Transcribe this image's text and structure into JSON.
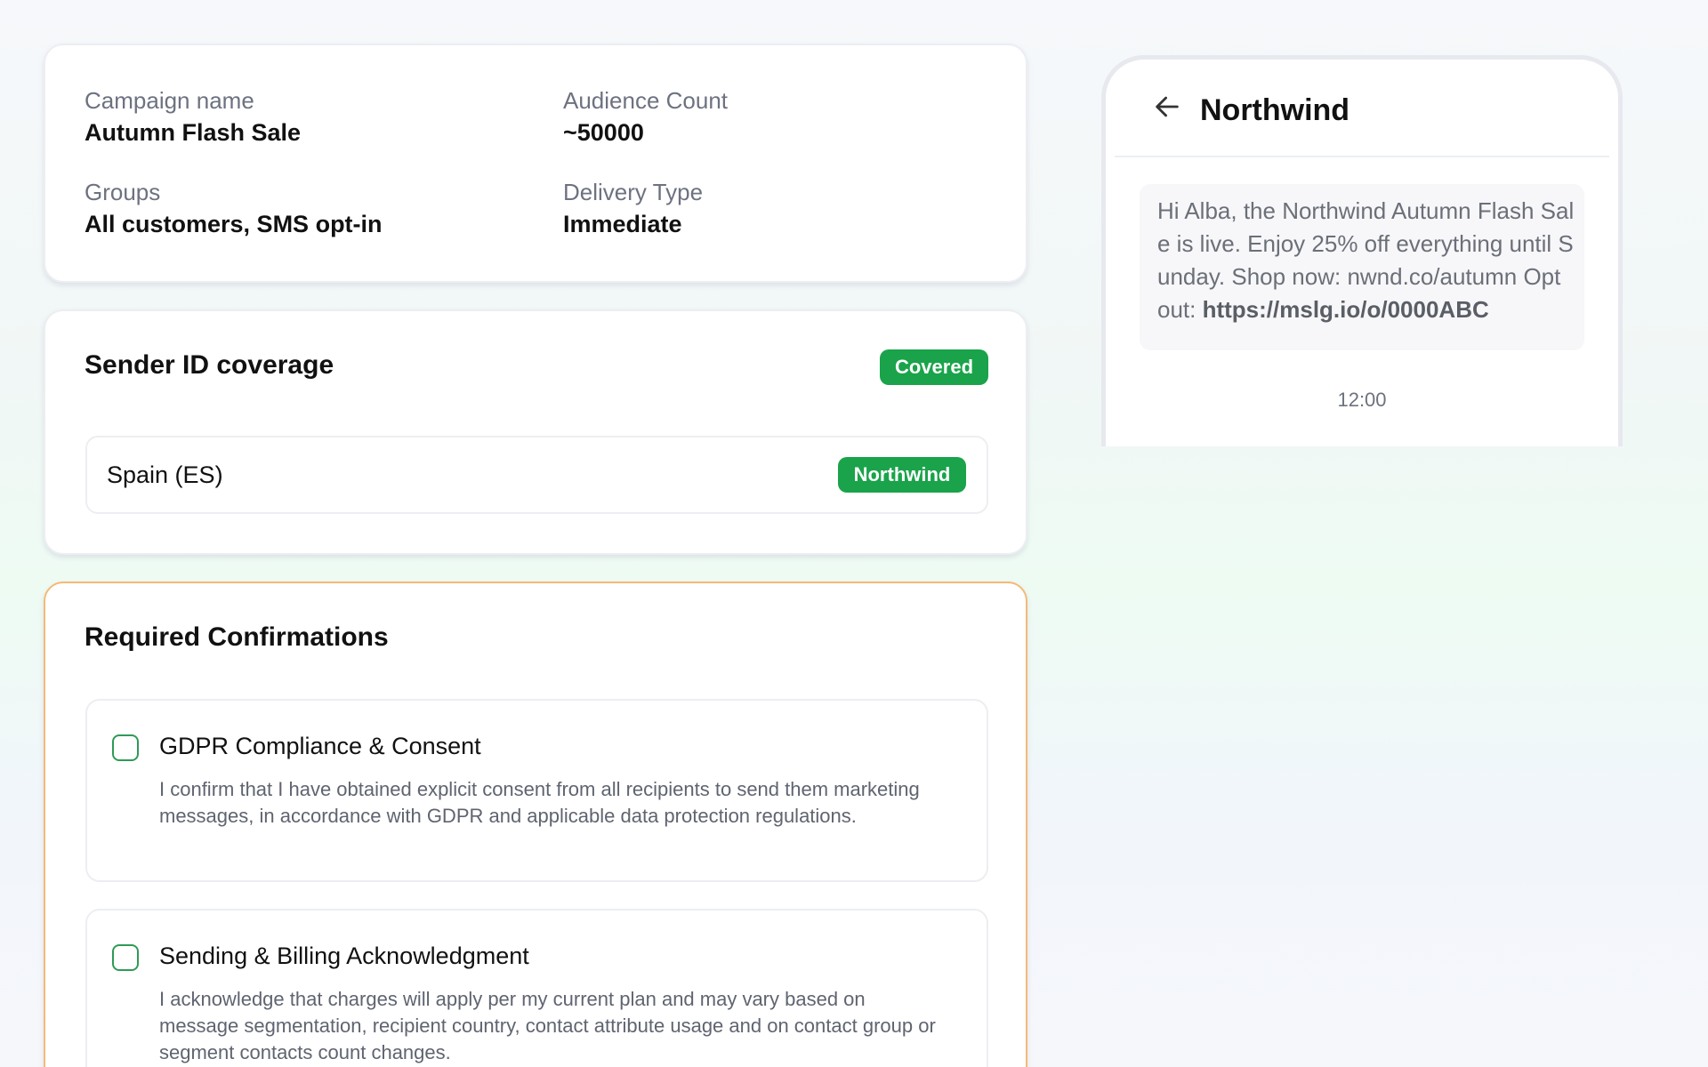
{
  "summary": {
    "campaign_name_label": "Campaign name",
    "campaign_name_value": "Autumn Flash Sale",
    "audience_label": "Audience Count",
    "audience_value": "~50000",
    "groups_label": "Groups",
    "groups_value": "All customers, SMS opt-in",
    "delivery_label": "Delivery Type",
    "delivery_value": "Immediate"
  },
  "sender": {
    "title": "Sender ID coverage",
    "status_badge": "Covered",
    "countries": [
      {
        "name": "Spain (ES)",
        "sender_id": "Northwind"
      }
    ]
  },
  "confirmations": {
    "title": "Required Confirmations",
    "items": [
      {
        "title": "GDPR Compliance & Consent",
        "text": "I confirm that I have obtained explicit consent from all recipients to send them marketing messages, in accordance with GDPR and applicable data protection regulations.",
        "checked": false
      },
      {
        "title": "Sending & Billing Acknowledgment",
        "text": "I acknowledge that charges will apply per my current plan and may vary based on message segmentation, recipient country, contact attribute usage and on contact group or segment contacts count changes.",
        "checked": false
      }
    ]
  },
  "preview": {
    "sender_name": "Northwind",
    "message_text": "Hi Alba, the Northwind Autumn Flash Sale is live. Enjoy 25% off everything until Sunday. Shop now: nwnd.co/autumn Opt out: ",
    "message_link": "https://mslg.io/o/0000ABC",
    "time": "12:00"
  },
  "colors": {
    "accent_green": "#1aa34a",
    "checkbox_green": "#2f9a56",
    "warning_border": "#f5b976"
  },
  "icons": {
    "back": "arrow-left-icon"
  }
}
